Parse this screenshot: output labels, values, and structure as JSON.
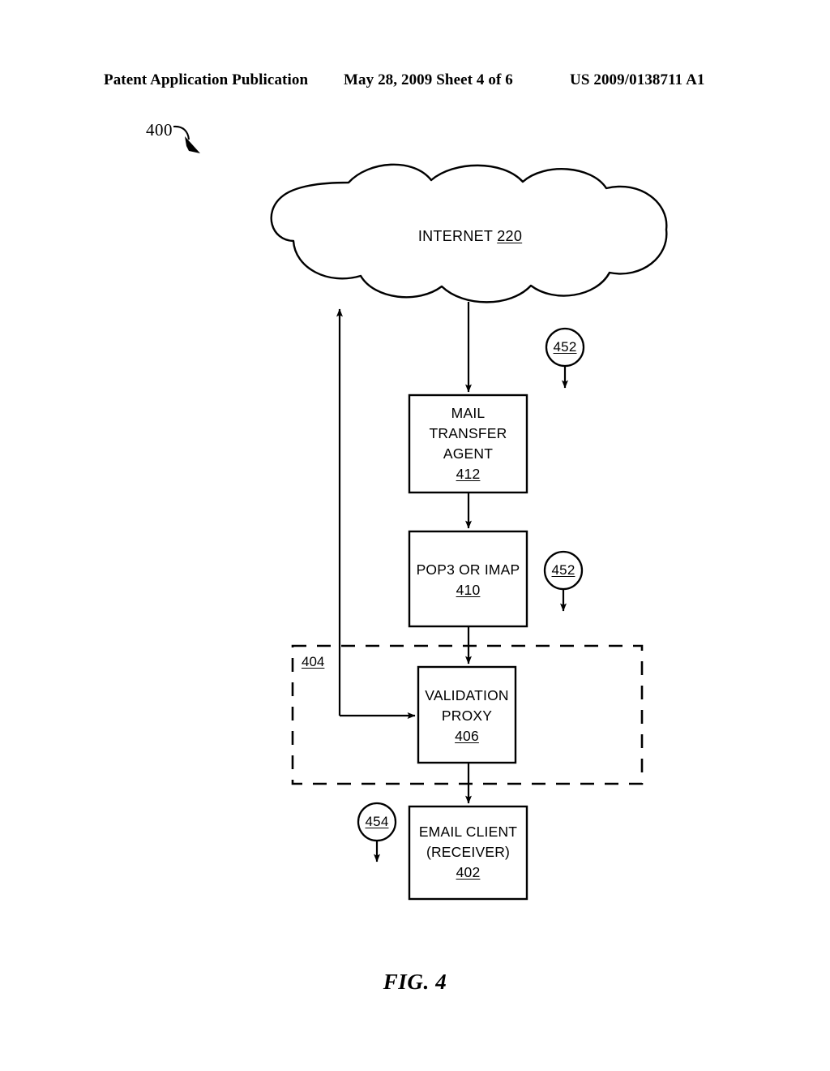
{
  "header": {
    "left": "Patent Application Publication",
    "middle": "May 28, 2009  Sheet 4 of 6",
    "right": "US 2009/0138711 A1"
  },
  "figure": {
    "ref_number": "400",
    "caption": "FIG. 4"
  },
  "cloud": {
    "label": "INTERNET",
    "ref": "220"
  },
  "boxes": [
    {
      "id": "mail-transfer-agent",
      "lines": [
        "MAIL",
        "TRANSFER",
        "AGENT"
      ],
      "ref": "412"
    },
    {
      "id": "pop3-or-imap",
      "lines": [
        "POP3 OR IMAP"
      ],
      "ref": "410"
    },
    {
      "id": "validation-proxy",
      "lines": [
        "VALIDATION",
        "PROXY"
      ],
      "ref": "406"
    },
    {
      "id": "email-client",
      "lines": [
        "EMAIL CLIENT",
        "(RECEIVER)"
      ],
      "ref": "402"
    }
  ],
  "dashed_group": {
    "ref": "404"
  },
  "callouts": [
    {
      "id": "callout-452-top",
      "ref": "452"
    },
    {
      "id": "callout-452-mid",
      "ref": "452"
    },
    {
      "id": "callout-454",
      "ref": "454"
    }
  ],
  "colors": {
    "stroke": "#000000",
    "background": "#ffffff"
  }
}
